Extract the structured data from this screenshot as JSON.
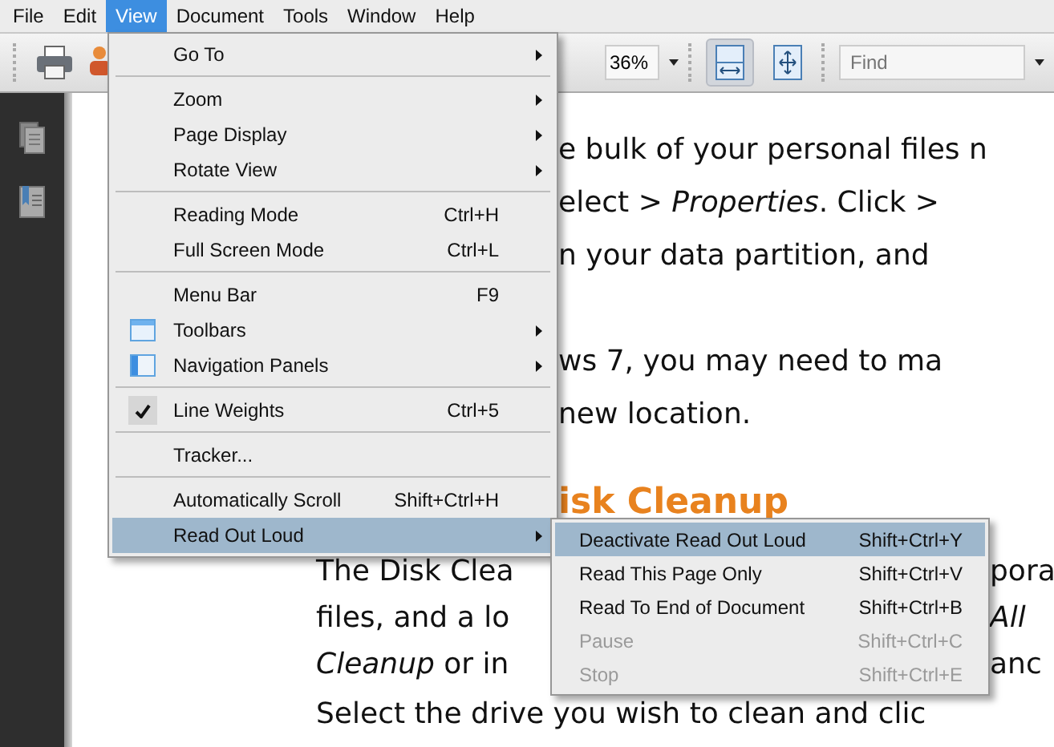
{
  "menu_bar": [
    {
      "label": "File",
      "selected": false
    },
    {
      "label": "Edit",
      "selected": false
    },
    {
      "label": "View",
      "selected": true
    },
    {
      "label": "Document",
      "selected": false
    },
    {
      "label": "Tools",
      "selected": false
    },
    {
      "label": "Window",
      "selected": false
    },
    {
      "label": "Help",
      "selected": false
    }
  ],
  "toolbar": {
    "zoom": "36%",
    "fit_width_selected": true,
    "find_placeholder": "Find"
  },
  "document": {
    "lines": [
      {
        "kind": "covered",
        "text": "e bulk of your personal files n"
      },
      {
        "kind": "covered",
        "text": "elect > *Properties*. Click >"
      },
      {
        "kind": "covered",
        "text": "n your data partition, and"
      },
      {
        "kind": "blank"
      },
      {
        "kind": "covered",
        "text": "ws 7, you may need to ma"
      },
      {
        "kind": "covered",
        "text": "new location."
      },
      {
        "kind": "heading",
        "text": "isk Cleanup"
      },
      {
        "kind": "split",
        "text": "The Disk Clea",
        "right": "pora"
      },
      {
        "kind": "split",
        "text": "files, and a lo",
        "right": "*All*"
      },
      {
        "kind": "split",
        "text": "*Cleanup* or in",
        "right": "anc"
      },
      {
        "kind": "text",
        "text": "Select the drive you wish to clean and clic"
      }
    ]
  },
  "view_menu": [
    {
      "kind": "item",
      "label": "Go To",
      "submenu": true,
      "selected": false
    },
    {
      "kind": "separator"
    },
    {
      "kind": "item",
      "label": "Zoom",
      "submenu": true,
      "selected": false
    },
    {
      "kind": "item",
      "label": "Page Display",
      "submenu": true,
      "selected": false
    },
    {
      "kind": "item",
      "label": "Rotate View",
      "submenu": true,
      "selected": false
    },
    {
      "kind": "separator"
    },
    {
      "kind": "item",
      "label": "Reading Mode",
      "shortcut": "Ctrl+H",
      "selected": false
    },
    {
      "kind": "item",
      "label": "Full Screen Mode",
      "shortcut": "Ctrl+L",
      "selected": false
    },
    {
      "kind": "separator"
    },
    {
      "kind": "item",
      "label": "Menu Bar",
      "shortcut": "F9",
      "selected": false
    },
    {
      "kind": "icon_item",
      "label": "Toolbars",
      "submenu": true,
      "selected": false
    },
    {
      "kind": "icon_item",
      "label": "Navigation Panels",
      "submenu": true,
      "selected": false
    },
    {
      "kind": "separator"
    },
    {
      "kind": "item",
      "label": "Line Weights",
      "shortcut": "Ctrl+5",
      "checked": true,
      "selected": false
    },
    {
      "kind": "separator"
    },
    {
      "kind": "item",
      "label": "Tracker...",
      "selected": false
    },
    {
      "kind": "separator"
    },
    {
      "kind": "item",
      "label": "Automatically Scroll",
      "shortcut": "Shift+Ctrl+H",
      "selected": false
    },
    {
      "kind": "item",
      "label": "Read Out Loud",
      "submenu": true,
      "selected": true
    }
  ],
  "read_out_loud_menu": [
    {
      "kind": "item",
      "label": "Deactivate Read Out Loud",
      "shortcut": "Shift+Ctrl+Y",
      "selected": true,
      "disabled": false
    },
    {
      "kind": "item",
      "label": "Read This Page Only",
      "shortcut": "Shift+Ctrl+V",
      "selected": false,
      "disabled": false
    },
    {
      "kind": "item",
      "label": "Read To End of Document",
      "shortcut": "Shift+Ctrl+B",
      "selected": false,
      "disabled": false
    },
    {
      "kind": "item",
      "label": "Pause",
      "shortcut": "Shift+Ctrl+C",
      "selected": false,
      "disabled": true
    },
    {
      "kind": "item",
      "label": "Stop",
      "shortcut": "Shift+Ctrl+E",
      "selected": false,
      "disabled": true
    }
  ]
}
